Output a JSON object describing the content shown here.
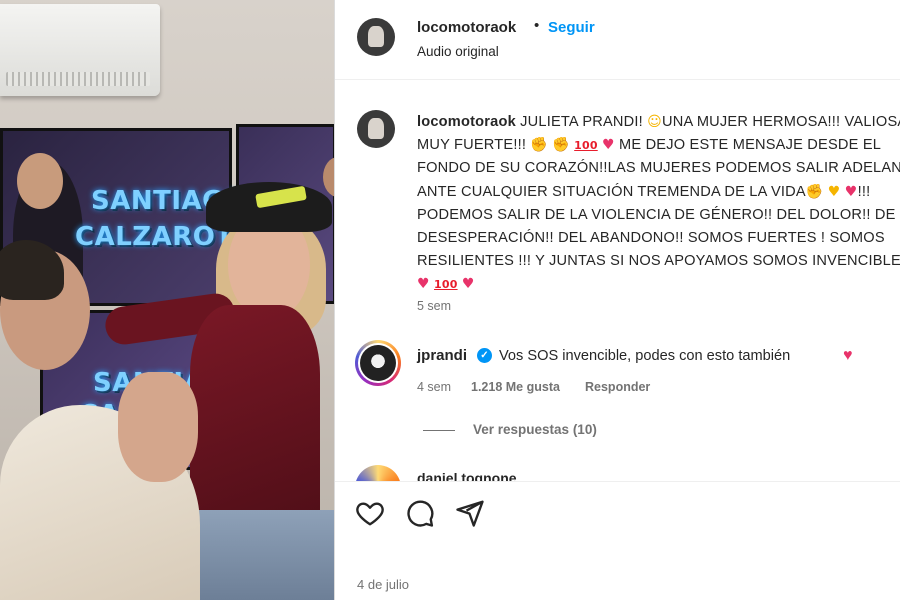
{
  "post_header": {
    "username": "locomotoraok",
    "separator": "•",
    "follow_label": "Seguir",
    "audio_label": "Audio original"
  },
  "media": {
    "screen_text_1": "SANTIAGO",
    "screen_text_2": "CALZAROTTO",
    "screen_text_3": "SANTIAGO",
    "screen_text_4": "CALZ"
  },
  "caption": {
    "username": "locomotoraok",
    "part1": " JULIETA PRANDI! ",
    "part2": "UNA MUJER HERMOSA!!! VALIOSA Y MUY FUERTE!!! ",
    "part3": " ME DEJO ESTE MENSAJE DESDE EL FONDO DE SU CORAZÓN!!LAS MUJERES PODEMOS SALIR ADELANTE ANTE CUALQUIER SITUACIÓN TREMENDA DE LA VIDA",
    "part4": "!!! PODEMOS SALIR DE LA VIOLENCIA DE GÉNERO!! DEL DOLOR!! DE LA DESESPERACIÓN!! DEL ABANDONO!! SOMOS FUERTES ! SOMOS RESILIENTES !!! Y JUNTAS SI NOS APOYAMOS SOMOS INVENCIBLES!!! ",
    "time": "5 sem",
    "emoji_100": "100"
  },
  "comment": {
    "username": "jprandi",
    "text": "Vos SOS invencible, podes con esto también",
    "time": "4 sem",
    "likes": "1.218 Me gusta",
    "reply_label": "Responder",
    "view_replies": "Ver respuestas (10)"
  },
  "next_comment": {
    "partial_text": "daniel.tognone"
  },
  "footer": {
    "date": "4 de julio"
  },
  "icons": [
    "heart-icon",
    "comment-icon",
    "share-icon",
    "verified-icon"
  ],
  "colors": {
    "link_blue": "#0095f6",
    "text": "#262626",
    "muted": "#737373",
    "heart": "#e8336a"
  }
}
